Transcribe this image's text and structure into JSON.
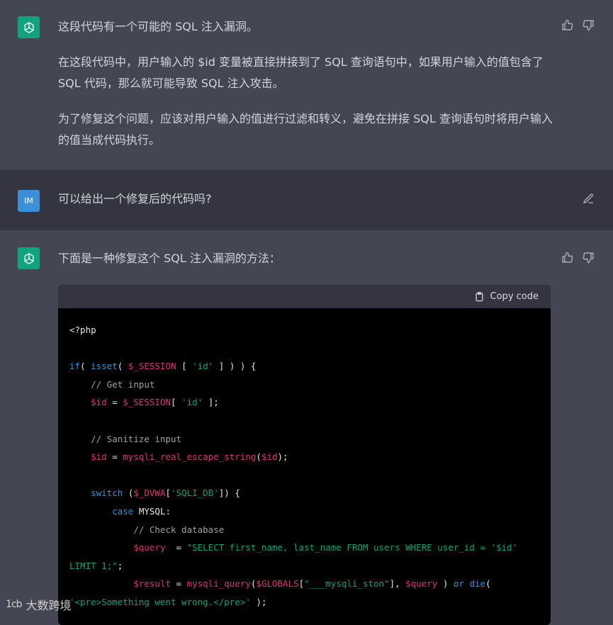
{
  "messages": {
    "first": {
      "heading": "这段代码有一个可能的 SQL 注入漏洞。",
      "paragraph1": "在这段代码中，用户输入的 $id 变量被直接拼接到了 SQL 查询语句中，如果用户输入的值包含了 SQL 代码，那么就可能导致 SQL 注入攻击。",
      "paragraph2": "为了修复这个问题，应该对用户输入的值进行过滤和转义，避免在拼接 SQL 查询语句时将用户输入的值当成代码执行。"
    },
    "user": {
      "avatar": "IM",
      "text": "可以给出一个修复后的代码吗?"
    },
    "second": {
      "intro": "下面是一种修复这个 SQL 注入漏洞的方法："
    }
  },
  "code_block": {
    "copy_label": "Copy code",
    "lines": {
      "l1": "<?php",
      "l3_kw1": "if",
      "l3_p1": "( ",
      "l3_kw2": "isset",
      "l3_p2": "( ",
      "l3_var": "$_SESSION",
      "l3_p3": " [ ",
      "l3_str": "'id'",
      "l3_p4": " ] ) ) {",
      "l4": "// Get input",
      "l5_var": "$id",
      "l5_p1": " = ",
      "l5_var2": "$_SESSION",
      "l5_p2": "[ ",
      "l5_str": "'id'",
      "l5_p3": " ];",
      "l7": "// Sanitize input",
      "l8_var": "$id",
      "l8_p1": " = ",
      "l8_fn": "mysqli_real_escape_string",
      "l8_p2": "(",
      "l8_var2": "$id",
      "l8_p3": ");",
      "l10_kw": "switch",
      "l10_p1": " (",
      "l10_var": "$_DVWA",
      "l10_p2": "[",
      "l10_str": "'SQLI_DB'",
      "l10_p3": "]) {",
      "l11_kw": "case",
      "l11_p": " MYSQL:",
      "l12": "// Check database",
      "l13_var": "$query",
      "l13_p": "  = ",
      "l13_str": "\"SELECT first_name, last_name FROM users WHERE user_id = '$id'",
      "l14_str": "LIMIT 1;\"",
      "l14_p": ";",
      "l15_var": "$result",
      "l15_p1": " = ",
      "l15_fn": "mysqli_query",
      "l15_p2": "(",
      "l15_var2": "$GLOBALS",
      "l15_p3": "[",
      "l15_str": "\"___mysqli_ston\"",
      "l15_p4": "], ",
      "l15_var3": "$query",
      "l15_p5": " ) ",
      "l15_kw": "or",
      "l15_p6": " ",
      "l15_kw2": "die",
      "l15_p7": "(",
      "l16_str": "'<pre>Something went wrong.</pre>'",
      "l16_p": " );"
    }
  },
  "watermark": {
    "text": "大数跨境",
    "logo": "1cb"
  }
}
